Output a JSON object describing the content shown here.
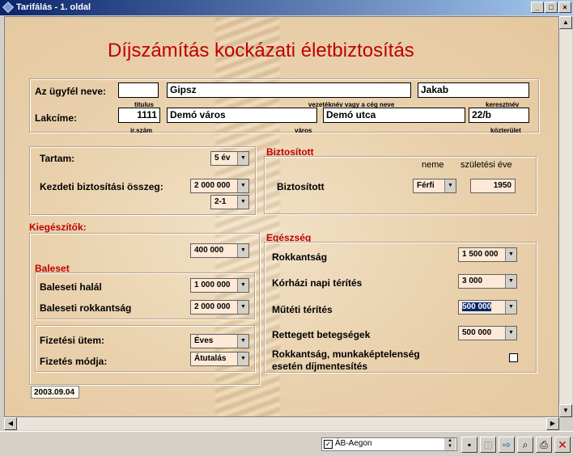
{
  "window": {
    "title": "Tarifálás - 1. oldal",
    "min": "_",
    "max": "□",
    "close": "×"
  },
  "heading": "Díjszámítás kockázati életbiztosítás",
  "client": {
    "name_label": "Az ügyfél neve:",
    "titulus_value": "",
    "titulus_label": "titulus",
    "lastname_value": "Gipsz",
    "lastname_label": "vezetéknév vagy a cég neve",
    "firstname_value": "Jakab",
    "firstname_label": "keresztnév",
    "address_label": "Lakcíme:",
    "zip_value": "1111",
    "zip_label": "ir.szám",
    "city_value": "Demó város",
    "city_label": "város",
    "street_value": "Demó utca",
    "street_label": "közterület",
    "number_value": "22/b"
  },
  "term": {
    "tartam_label": "Tartam:",
    "tartam_value": "5 év",
    "sum_label": "Kezdeti biztosítási összeg:",
    "sum_value": "2 000 000",
    "ratio_value": "2-1"
  },
  "insured": {
    "section": "Biztosított",
    "gender_hdr": "neme",
    "birth_hdr": "születési éve",
    "row_label": "Biztosított",
    "gender_value": "Férfi",
    "birth_value": "1950"
  },
  "extras": {
    "section": "Kiegészítők:",
    "top_value": "400 000",
    "accident_section": "Baleset",
    "death_label": "Baleseti halál",
    "death_value": "1 000 000",
    "disab_label": "Baleseti rokkantság",
    "disab_value": "2 000 000",
    "pay_freq_label": "Fizetési ütem:",
    "pay_freq_value": "Éves",
    "pay_mode_label": "Fizetés módja:",
    "pay_mode_value": "Átutalás"
  },
  "health": {
    "section": "Egészség",
    "disab_label": "Rokkantság",
    "disab_value": "1 500 000",
    "hosp_label": "Kórházi napi térítés",
    "hosp_value": "3 000",
    "surg_label": "Műtéti térítés",
    "surg_value": "500 000",
    "dread_label": "Rettegett betegségek",
    "dread_value": "500 000",
    "waiver_label1": "Rokkantság, munkaképtelenség",
    "waiver_label2": "esetén díjmentesítés"
  },
  "date": "2003.09.04",
  "bottom": {
    "combo_value": "ÁB-Aegon",
    "icons": [
      "save-icon",
      "delete-page-icon",
      "export-icon",
      "preview-icon",
      "print-icon",
      "close-icon"
    ]
  }
}
